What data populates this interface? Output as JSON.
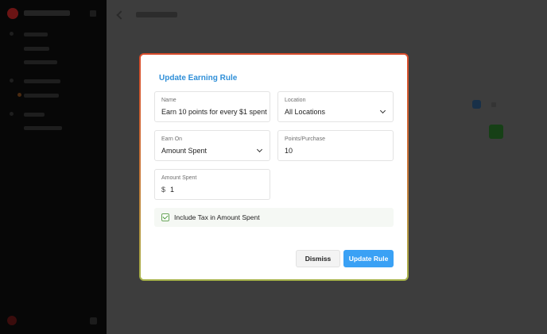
{
  "modal": {
    "title": "Update Earning Rule",
    "fields": {
      "name": {
        "label": "Name",
        "value": "Earn 10 points for every $1 spent"
      },
      "location": {
        "label": "Location",
        "value": "All Locations"
      },
      "earn_on": {
        "label": "Earn On",
        "value": "Amount Spent"
      },
      "points_purchase": {
        "label": "Points/Purchase",
        "value": "10"
      },
      "amount_spent": {
        "label": "Amount Spent",
        "prefix": "$",
        "value": "1"
      }
    },
    "include_tax": {
      "label": "Include Tax in Amount Spent",
      "checked": true
    },
    "buttons": {
      "dismiss": "Dismiss",
      "update": "Update Rule"
    }
  },
  "colors": {
    "accent": "#3aa1f5",
    "title": "#2f8fd8",
    "check": "#4a9a3a",
    "frame_top": "#d94b2b",
    "frame_bottom": "#a6b24a"
  },
  "icons": [
    "chevron-down-icon",
    "checkmark-icon",
    "back-arrow-icon"
  ]
}
